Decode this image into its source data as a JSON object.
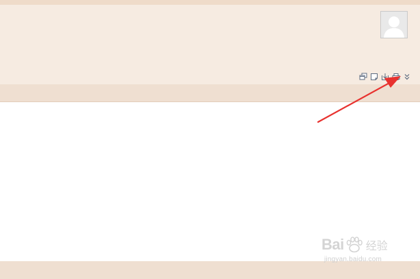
{
  "header": {
    "avatar_icon": "default-user-avatar-icon",
    "toolbar": {
      "buttons": [
        {
          "icon": "restore-window-icon"
        },
        {
          "icon": "note-icon"
        },
        {
          "icon": "download-icon"
        },
        {
          "icon": "print-icon"
        },
        {
          "icon": "double-chevron-down-icon"
        }
      ]
    }
  },
  "annotation": {
    "color": "#e8322f",
    "points_to": "print-icon"
  },
  "watermark": {
    "brand": "Bai",
    "brand_suffix": "经验",
    "url": "jingyan.baidu.com"
  },
  "colors": {
    "header_bg": "#f6ebe1",
    "bar_bg": "#efdfd1",
    "icon": "#5c6b80"
  }
}
